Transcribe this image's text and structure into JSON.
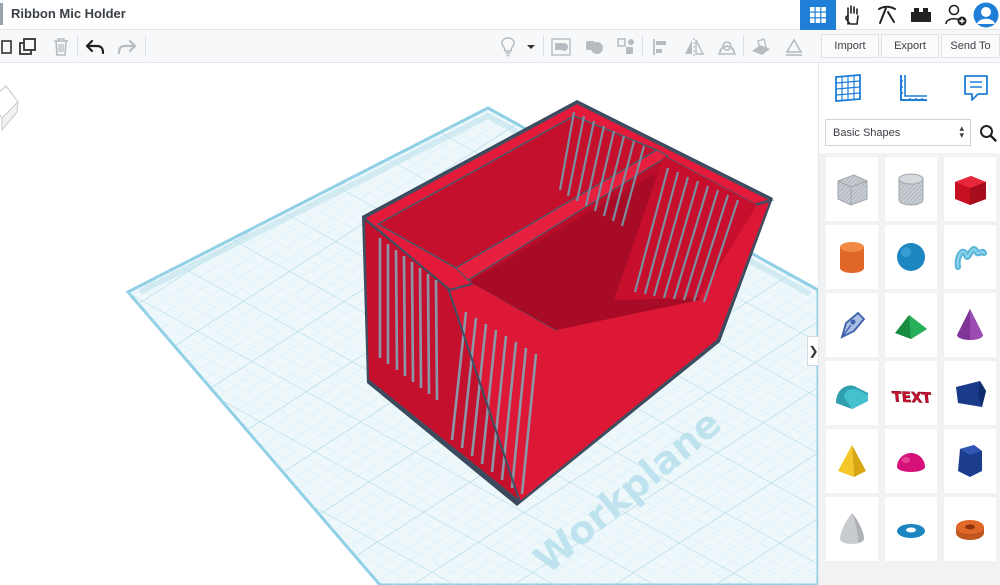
{
  "app": {
    "title": "Ribbon Mic Holder"
  },
  "top_nav": {
    "items": [
      {
        "name": "3d-design-view",
        "icon": "grid-icon",
        "active": true
      },
      {
        "name": "blocks-view",
        "icon": "hand-badge-icon"
      },
      {
        "name": "bricks-view",
        "icon": "pickaxe-icon"
      },
      {
        "name": "lego-view",
        "icon": "brick-icon"
      },
      {
        "name": "invite-user",
        "icon": "add-user-icon"
      },
      {
        "name": "profile",
        "icon": "avatar-icon"
      }
    ]
  },
  "toolbar": {
    "left_icons": [
      "copy-icon",
      "duplicate-icon",
      "delete-icon",
      "undo-icon",
      "redo-icon"
    ],
    "right_icons": [
      "light-bulb-icon",
      "dropdown-icon",
      "group-icon",
      "ungroup-icon",
      "align-icon",
      "flip-icon",
      "mirror-icon",
      "workplane-icon",
      "ruler-icon",
      "note-icon"
    ],
    "import_label": "Import",
    "export_label": "Export",
    "send_to_label": "Send To"
  },
  "viewport": {
    "workplane_text": "Workplane",
    "object_color": "#d0122f",
    "grid_color": "#bfe3ee"
  },
  "panel": {
    "tabs": [
      "workplane-grid-icon",
      "ruler-tool-icon",
      "notes-icon"
    ],
    "category": "Basic Shapes",
    "collapse_arrow": "❯",
    "shapes": [
      {
        "name": "box-hole",
        "color": "#b8bec4"
      },
      {
        "name": "cylinder-hole",
        "color": "#b8bec4"
      },
      {
        "name": "box",
        "color": "#d8132a"
      },
      {
        "name": "cylinder",
        "color": "#e2682a"
      },
      {
        "name": "sphere",
        "color": "#1c8ac4"
      },
      {
        "name": "scribble",
        "color": "#58b6d9"
      },
      {
        "name": "shape-generator",
        "color": "#4b6fb6"
      },
      {
        "name": "roof",
        "color": "#1f9c4a"
      },
      {
        "name": "cone",
        "color": "#8a3ea0"
      },
      {
        "name": "round-roof",
        "color": "#3bb2c1"
      },
      {
        "name": "text",
        "color": "#c8102e"
      },
      {
        "name": "wedge",
        "color": "#1a3b8a"
      },
      {
        "name": "pyramid",
        "color": "#f0c020"
      },
      {
        "name": "half-sphere",
        "color": "#d6127a"
      },
      {
        "name": "polygon",
        "color": "#1c3c8e"
      },
      {
        "name": "paraboloid",
        "color": "#c9cccf"
      },
      {
        "name": "torus",
        "color": "#1c8ac4"
      },
      {
        "name": "tube",
        "color": "#e2682a"
      }
    ]
  }
}
